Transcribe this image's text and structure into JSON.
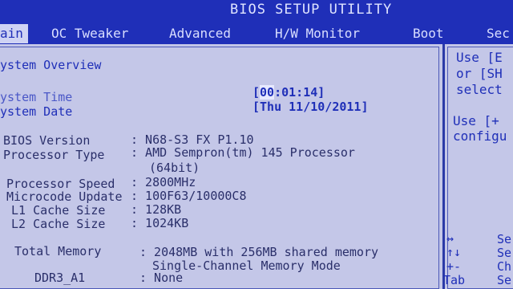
{
  "header": {
    "title": "BIOS SETUP UTILITY",
    "tabs": [
      {
        "label": "ain",
        "active": true
      },
      {
        "label": "OC Tweaker",
        "active": false
      },
      {
        "label": "Advanced",
        "active": false
      },
      {
        "label": "H/W Monitor",
        "active": false
      },
      {
        "label": "Boot",
        "active": false
      },
      {
        "label": "Sec",
        "active": false
      }
    ]
  },
  "overview": {
    "section_title": "ystem Overview",
    "system_time_label": "ystem Time",
    "system_time_value_prefix": "[",
    "system_time_selected": "00",
    "system_time_value_suffix": ":01:14]",
    "system_date_label": "ystem Date",
    "system_date_value": "[Thu 11/10/2011]",
    "bios_version_label": "BIOS Version",
    "bios_version_value": ": N68-S3 FX P1.10",
    "processor_type_label": "Processor Type",
    "processor_type_value": ": AMD Sempron(tm) 145 Processor",
    "processor_type_value_cont": "(64bit)",
    "processor_speed_label": "Processor Speed",
    "processor_speed_value": ": 2800MHz",
    "microcode_label": "Microcode Update",
    "microcode_value": ": 100F63/10000C8",
    "l1_label": "L1 Cache Size",
    "l1_value": ": 128KB",
    "l2_label": "L2 Cache Size",
    "l2_value": ": 1024KB",
    "total_memory_label": "Total Memory",
    "total_memory_value": ": 2048MB with 256MB shared memory",
    "total_memory_value_cont": "Single-Channel Memory Mode",
    "ddr3_a1_label": "DDR3_A1",
    "ddr3_a1_value": ": None"
  },
  "help": {
    "line1": "Use [E",
    "line2": "or [SH",
    "line3": "select",
    "line4": "Use [+",
    "line5": "configu",
    "keys": [
      {
        "key": "↔",
        "desc": "Se"
      },
      {
        "key": "↑↓",
        "desc": "Se"
      },
      {
        "key": "+-",
        "desc": "Ch"
      },
      {
        "key": "Tab",
        "desc": "Se"
      }
    ]
  }
}
